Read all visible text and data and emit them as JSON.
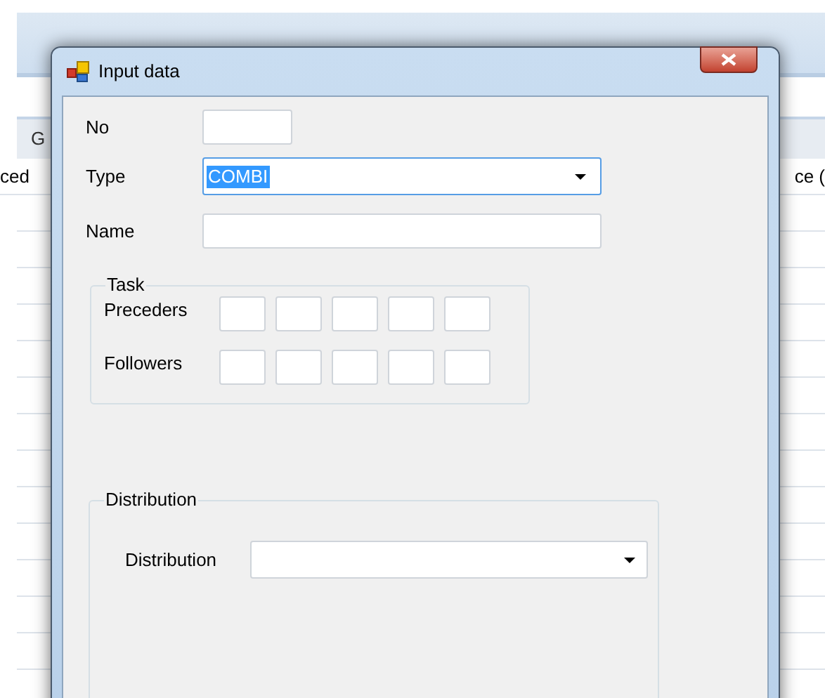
{
  "background": {
    "header_cells": [
      "G"
    ],
    "column_headers": [
      "ced",
      "ce ("
    ]
  },
  "dialog": {
    "title": "Input data",
    "fields": [
      {
        "label": "No",
        "kind": "text"
      },
      {
        "label": "Type",
        "kind": "combo",
        "value": "COMBI",
        "text_selected": true
      },
      {
        "label": "Name",
        "kind": "text"
      }
    ],
    "task": {
      "title": "Task",
      "rows": [
        {
          "label": "Preceders"
        },
        {
          "label": "Followers"
        }
      ]
    },
    "distribution": {
      "title": "Distribution",
      "label": "Distribution"
    }
  }
}
